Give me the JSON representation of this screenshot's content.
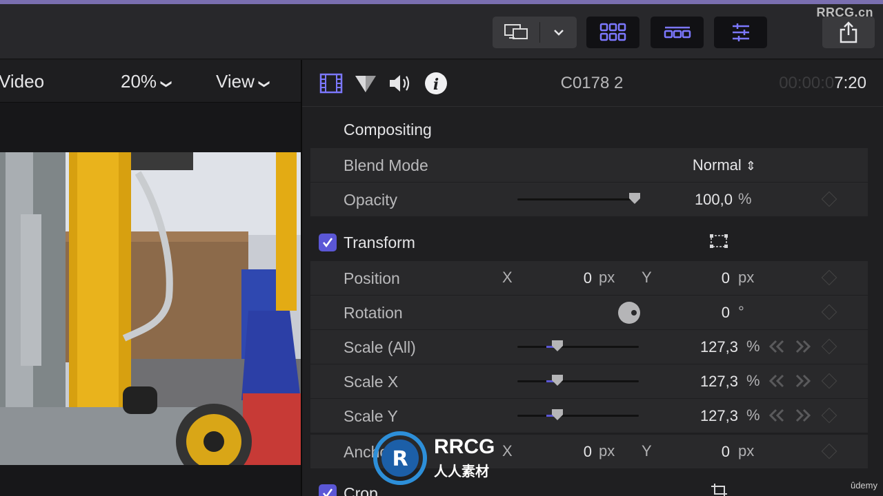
{
  "watermark": {
    "top_right": "RRCG.cn",
    "bottom_text": "RRCG",
    "bottom_sub": "人人素材",
    "udemy": "ûdemy"
  },
  "toolbar": {
    "buttons": [
      "display-layout-icon",
      "chevron-down-icon",
      "libraries-browser-icon",
      "timeline-icon",
      "inspector-icon",
      "share-icon"
    ],
    "accent": "#7c78ff"
  },
  "viewer": {
    "title": "Video",
    "zoom": "20%",
    "view_label": "View"
  },
  "inspector": {
    "tabs": [
      "video-tab-icon",
      "color-tab-icon",
      "audio-tab-icon",
      "info-tab-icon"
    ],
    "clip_name": "C0178 2",
    "timecode_dim": "00:00:0",
    "timecode_bright": "7:20",
    "compositing": {
      "title": "Compositing",
      "blend_mode_label": "Blend Mode",
      "blend_mode_value": "Normal",
      "opacity_label": "Opacity",
      "opacity_value": "100,0",
      "opacity_unit": "%",
      "opacity_level": 1.0
    },
    "transform": {
      "title": "Transform",
      "enabled": true,
      "position_label": "Position",
      "position_x_axis": "X",
      "position_x": "0",
      "position_x_unit": "px",
      "position_y_axis": "Y",
      "position_y": "0",
      "position_y_unit": "px",
      "rotation_label": "Rotation",
      "rotation_value": "0",
      "rotation_unit": "°",
      "scale_all_label": "Scale (All)",
      "scale_all_value": "127,3",
      "scale_x_label": "Scale X",
      "scale_x_value": "127,3",
      "scale_y_label": "Scale Y",
      "scale_y_value": "127,3",
      "scale_unit": "%",
      "anchor_label": "Anchor",
      "anchor_x_axis": "X",
      "anchor_x": "0",
      "anchor_x_unit": "px",
      "anchor_y_axis": "Y",
      "anchor_y": "0",
      "anchor_y_unit": "px"
    },
    "crop": {
      "title": "Crop",
      "enabled": true
    }
  }
}
